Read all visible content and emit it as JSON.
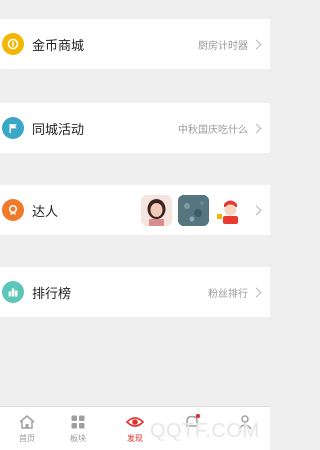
{
  "menu": {
    "coin_mall": {
      "label": "金币商城",
      "detail": "厨房计时器"
    },
    "local_events": {
      "label": "同城活动",
      "detail": "中秋国庆吃什么"
    },
    "experts": {
      "label": "达人"
    },
    "ranking": {
      "label": "排行榜",
      "detail": "粉丝排行"
    }
  },
  "tabbar": {
    "tabs": [
      {
        "label": "首页",
        "icon": "home-icon"
      },
      {
        "label": "板块",
        "icon": "grid-icon"
      },
      {
        "label": "发现",
        "icon": "eye-icon",
        "active": true
      },
      {
        "label": "",
        "icon": "notification-icon"
      },
      {
        "label": "",
        "icon": "profile-icon"
      }
    ]
  },
  "watermark": "QQTF.COM",
  "colors": {
    "coin_icon": "#f2b705",
    "events_icon": "#3aa7c6",
    "experts_icon": "#f0792b",
    "ranking_icon": "#5cc6b8",
    "active_tab": "#e2312a"
  }
}
